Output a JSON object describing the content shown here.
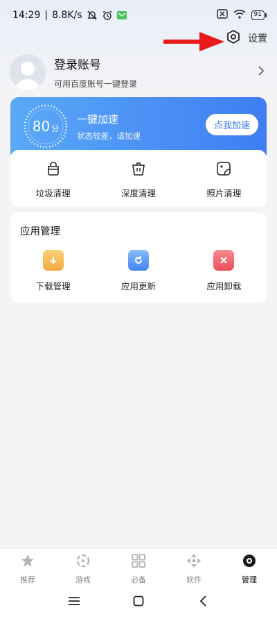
{
  "status_bar": {
    "time": "14:29",
    "speed": "8.8K/s",
    "battery": "91"
  },
  "header": {
    "settings_label": "设置"
  },
  "profile": {
    "title": "登录账号",
    "subtitle": "可用百度账号一键登录"
  },
  "boost": {
    "score": "80",
    "score_unit": "分",
    "title": "一键加速",
    "subtitle": "状态较差，请加速",
    "button_label": "点我加速",
    "accent_color": "#3f7df3"
  },
  "tools": [
    {
      "label": "垃圾清理",
      "icon": "trash-can-icon"
    },
    {
      "label": "深度清理",
      "icon": "deep-clean-bin-icon"
    },
    {
      "label": "照片清理",
      "icon": "photo-icon"
    }
  ],
  "app_management": {
    "title": "应用管理",
    "items": [
      {
        "label": "下载管理",
        "icon": "download-icon",
        "color": "#f6b74a"
      },
      {
        "label": "应用更新",
        "icon": "update-icon",
        "color": "#4e92f3"
      },
      {
        "label": "应用卸载",
        "icon": "uninstall-icon",
        "color": "#f2636a"
      }
    ]
  },
  "tab_bar": {
    "tabs": [
      {
        "label": "推荐",
        "icon": "star-icon"
      },
      {
        "label": "游戏",
        "icon": "game-icon"
      },
      {
        "label": "必备",
        "icon": "grid-icon"
      },
      {
        "label": "软件",
        "icon": "software-icon"
      },
      {
        "label": "管理",
        "icon": "manage-icon",
        "active": true
      }
    ]
  }
}
